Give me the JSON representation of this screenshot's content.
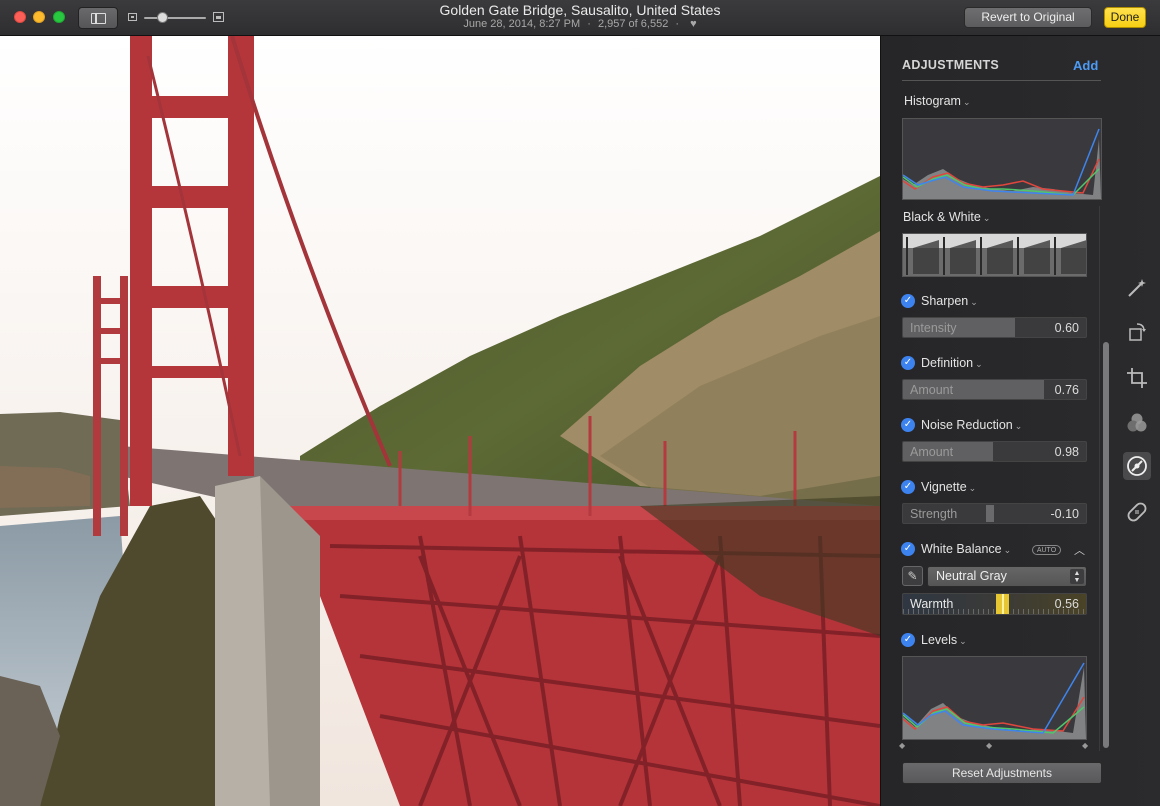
{
  "window": {
    "title": "Golden Gate Bridge, Sausalito, United States",
    "date": "June 28, 2014, 8:27 PM",
    "sep1": "·",
    "count": "2,957 of 6,552",
    "sep2": "·",
    "revert_label": "Revert to Original",
    "done_label": "Done",
    "accent_done": "#f7cf13"
  },
  "panel": {
    "header": "ADJUSTMENTS",
    "add_label": "Add",
    "histogram": {
      "title": "Histogram",
      "chevron": "⌄"
    },
    "black_white": {
      "title": "Black & White",
      "chevron": "⌄"
    },
    "sharpen": {
      "title": "Sharpen",
      "chevron": "⌄",
      "enabled": true,
      "slider": {
        "label": "Intensity",
        "value": "0.60",
        "level": 0.6
      }
    },
    "definition": {
      "title": "Definition",
      "chevron": "⌄",
      "enabled": true,
      "slider": {
        "label": "Amount",
        "value": "0.76",
        "level": 0.76
      }
    },
    "noise": {
      "title": "Noise Reduction",
      "chevron": "⌄",
      "enabled": true,
      "slider": {
        "label": "Amount",
        "value": "0.98",
        "level": 0.49
      }
    },
    "vignette": {
      "title": "Vignette",
      "chevron": "⌄",
      "enabled": true,
      "slider": {
        "label": "Strength",
        "value": "-0.10"
      }
    },
    "white_balance": {
      "title": "White Balance",
      "chevron": "⌄",
      "enabled": true,
      "auto_label": "AUTO",
      "preset": "Neutral Gray",
      "warmth": {
        "label": "Warmth",
        "value": "0.56"
      }
    },
    "levels": {
      "title": "Levels",
      "chevron": "⌄",
      "enabled": true
    },
    "reset_label": "Reset Adjustments",
    "check_glyph": "✓",
    "accent": "#3d83f0"
  },
  "tools": [
    "magic-wand-icon",
    "rotate-icon",
    "crop-icon",
    "filters-icon",
    "adjust-icon",
    "retouch-icon"
  ]
}
